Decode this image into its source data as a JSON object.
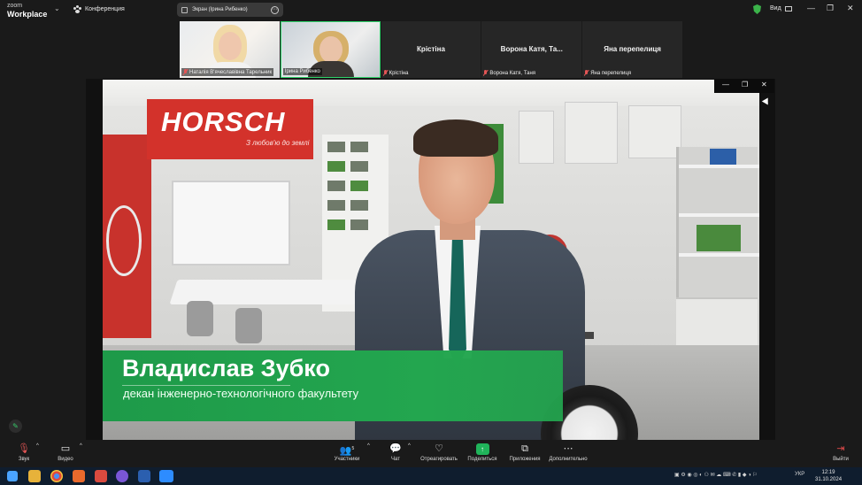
{
  "app": {
    "brand_small": "zoom",
    "brand_main": "Workplace",
    "meeting_label": "Конференция",
    "screen_share_label": "Экран (Ірина Рибенко)",
    "view_label": "Вид"
  },
  "participants": [
    {
      "name": "Наталія В'ячеславівна Тарельник",
      "video": true
    },
    {
      "name": "Ірина Рибенко",
      "video": true,
      "active_speaker": true
    },
    {
      "name": "Крістіна",
      "display_name": "Крістіна",
      "muted": true
    },
    {
      "name": "Ворона Катя, Таня",
      "display_name": "Ворона Катя, Та...",
      "muted": true
    },
    {
      "name": "Яна перепелиця",
      "display_name": "Яна перепелиця",
      "muted": true
    }
  ],
  "shared_content": {
    "sign_logo": "HORSCH",
    "sign_slogan": "З любов'ю до землі",
    "speaker_name": "Владислав Зубко",
    "speaker_role": "декан інженерно-технологічного факультету"
  },
  "toolbar": {
    "audio": "Звук",
    "video": "Видео",
    "participants": "Участники",
    "participants_count": "5",
    "chat": "Чат",
    "react": "Отреагировать",
    "share": "Поделиться",
    "apps": "Приложения",
    "more": "Дополнительно",
    "leave": "Выйти"
  },
  "taskbar": {
    "language": "УКР",
    "time": "12:19",
    "date": "31.10.2024"
  },
  "colors": {
    "active_speaker_border": "#2fd36a",
    "share_green": "#20b45a",
    "banner_green": "#23a64f",
    "muted_red": "#e25555",
    "horsch_red": "#d3322b"
  }
}
